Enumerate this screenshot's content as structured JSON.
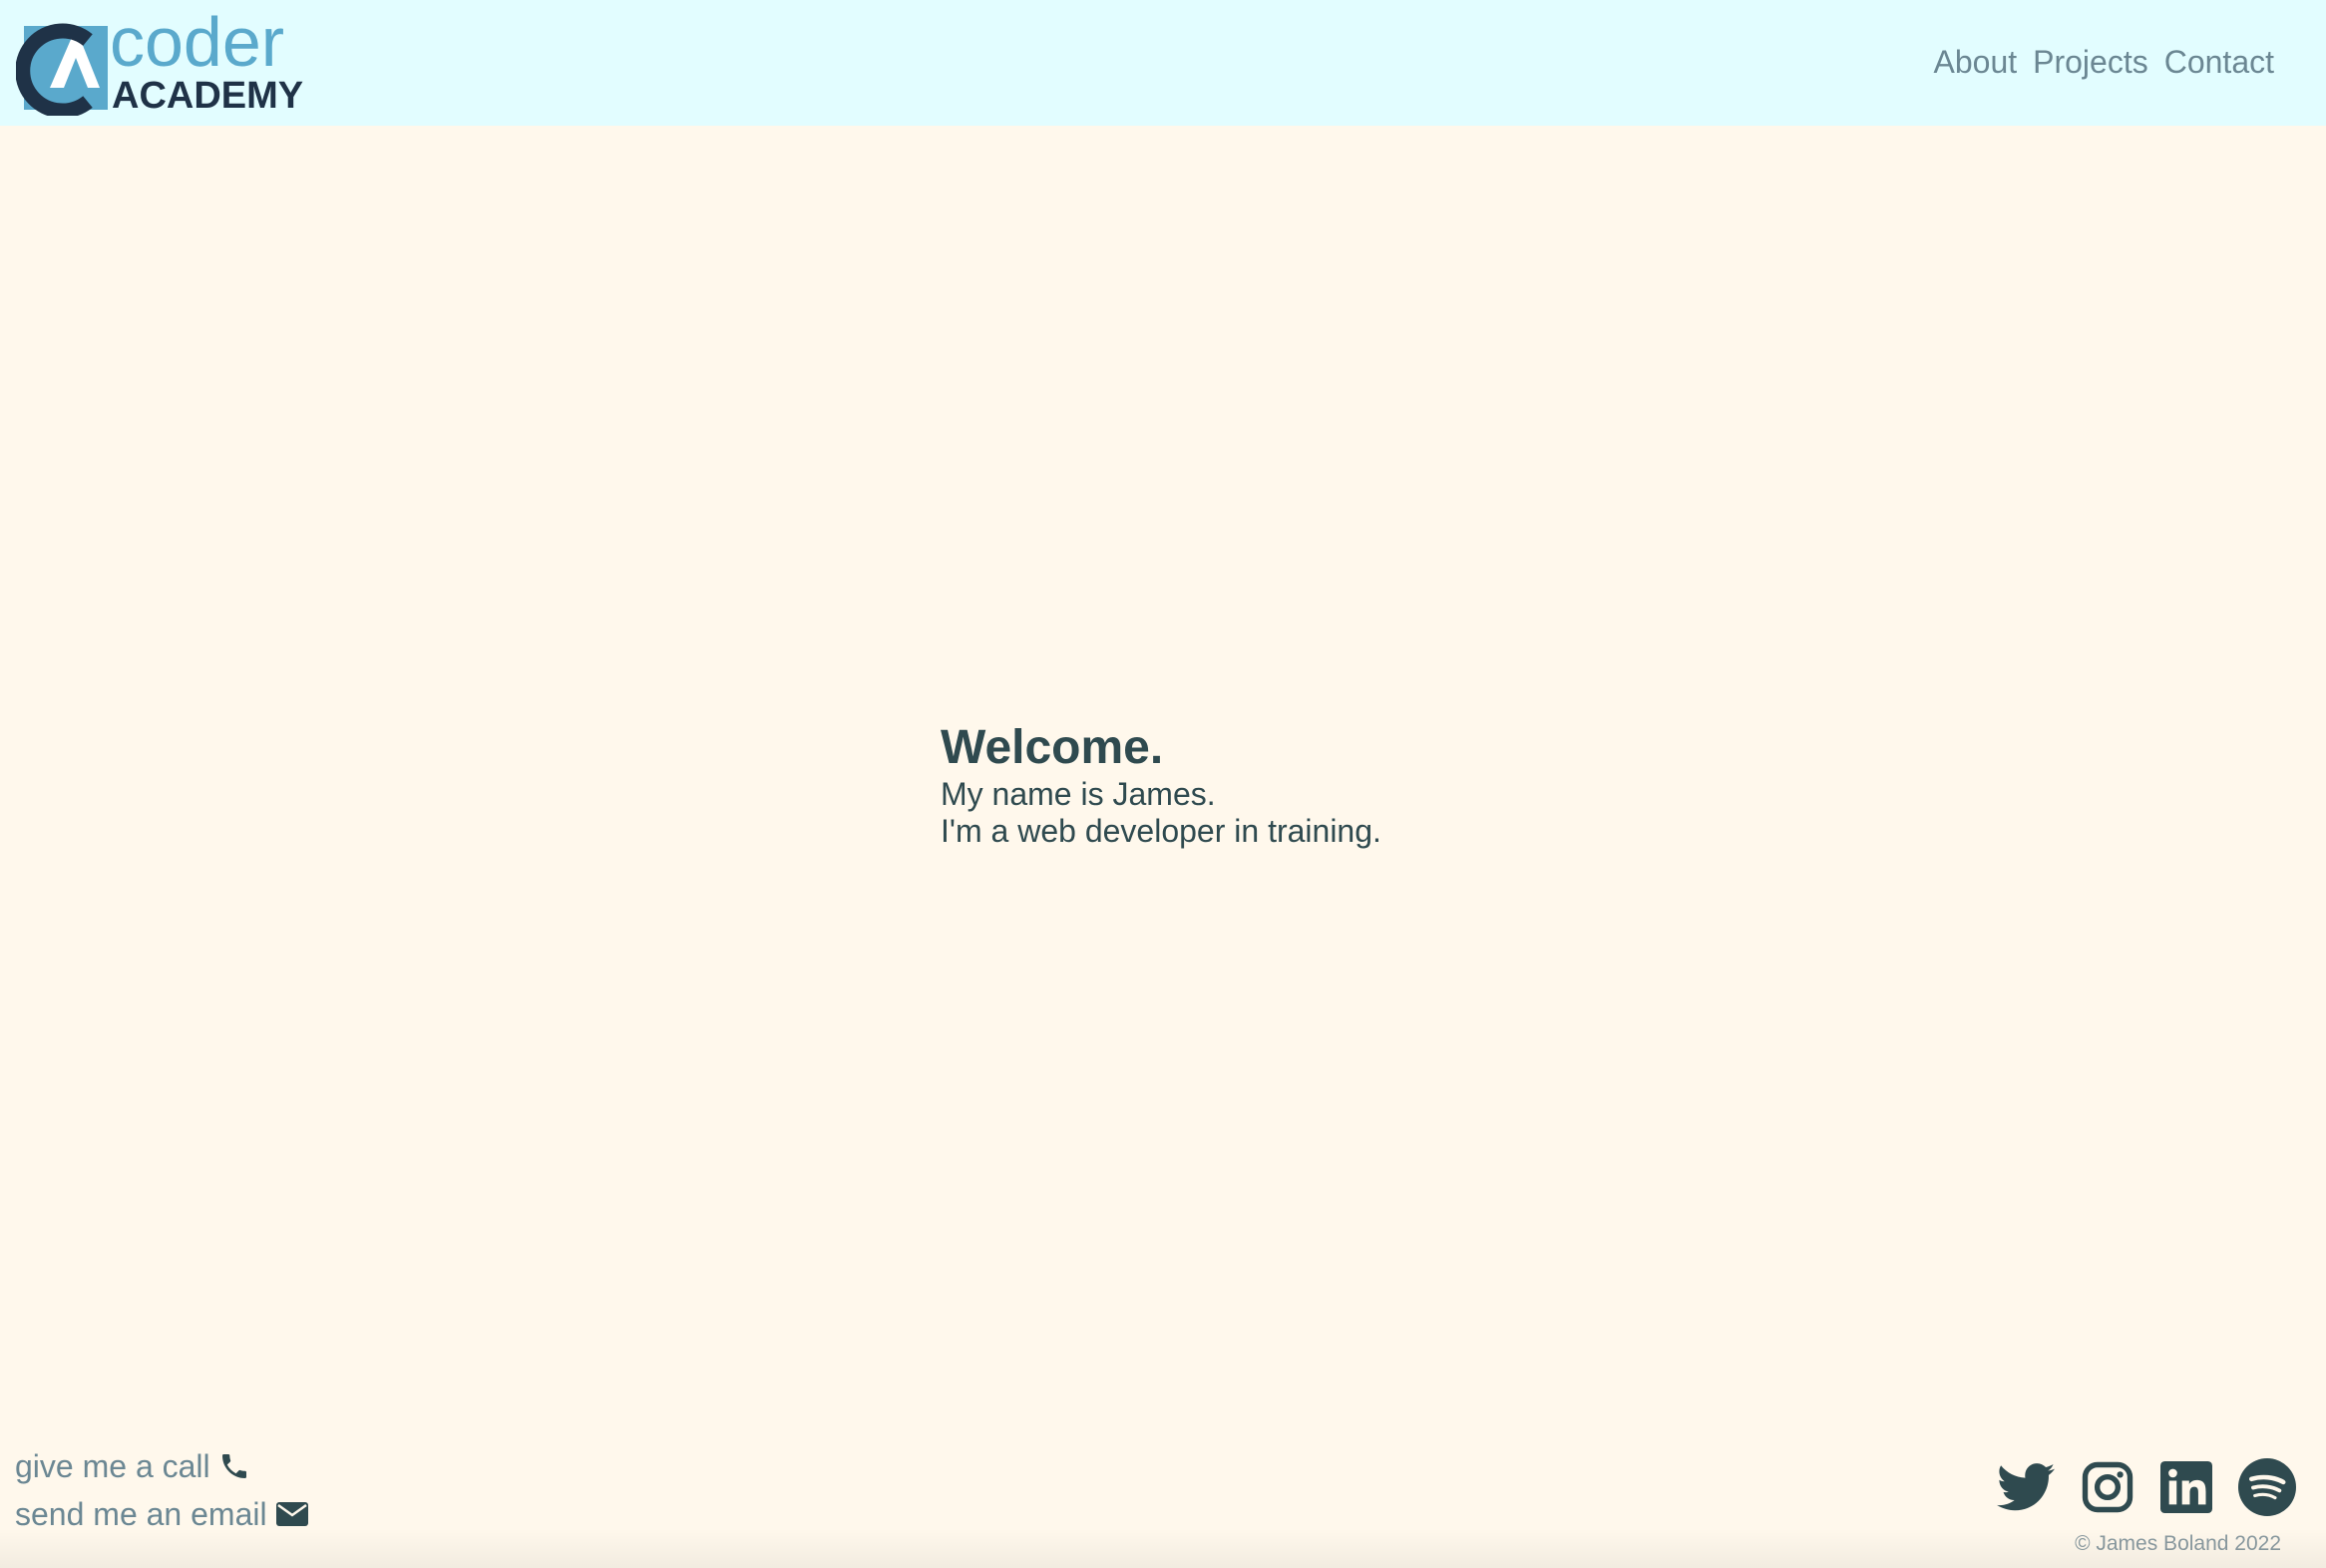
{
  "header": {
    "logo": {
      "text_top": "coder",
      "text_bottom": "ACADEMY",
      "icon": "coder-academy-logo"
    },
    "nav": [
      {
        "label": "About"
      },
      {
        "label": "Projects"
      },
      {
        "label": "Contact"
      }
    ]
  },
  "hero": {
    "title": "Welcome.",
    "line1": "My name is James.",
    "line2": "I'm a web developer in training."
  },
  "contact": {
    "call_label": "give me a call",
    "call_icon": "phone-icon",
    "email_label": "send me an email",
    "email_icon": "envelope-icon"
  },
  "social": {
    "icons": [
      "twitter-icon",
      "instagram-icon",
      "linkedin-icon",
      "spotify-icon"
    ]
  },
  "footer": {
    "copyright": "© James Boland 2022"
  },
  "colors": {
    "header_bg": "#e2fdff",
    "page_bg": "#fff8ec",
    "text_dark": "#2f4a4f",
    "link_muted": "#6b8793",
    "logo_light_blue": "#5aa9cc",
    "logo_dark_navy": "#1f3247"
  }
}
